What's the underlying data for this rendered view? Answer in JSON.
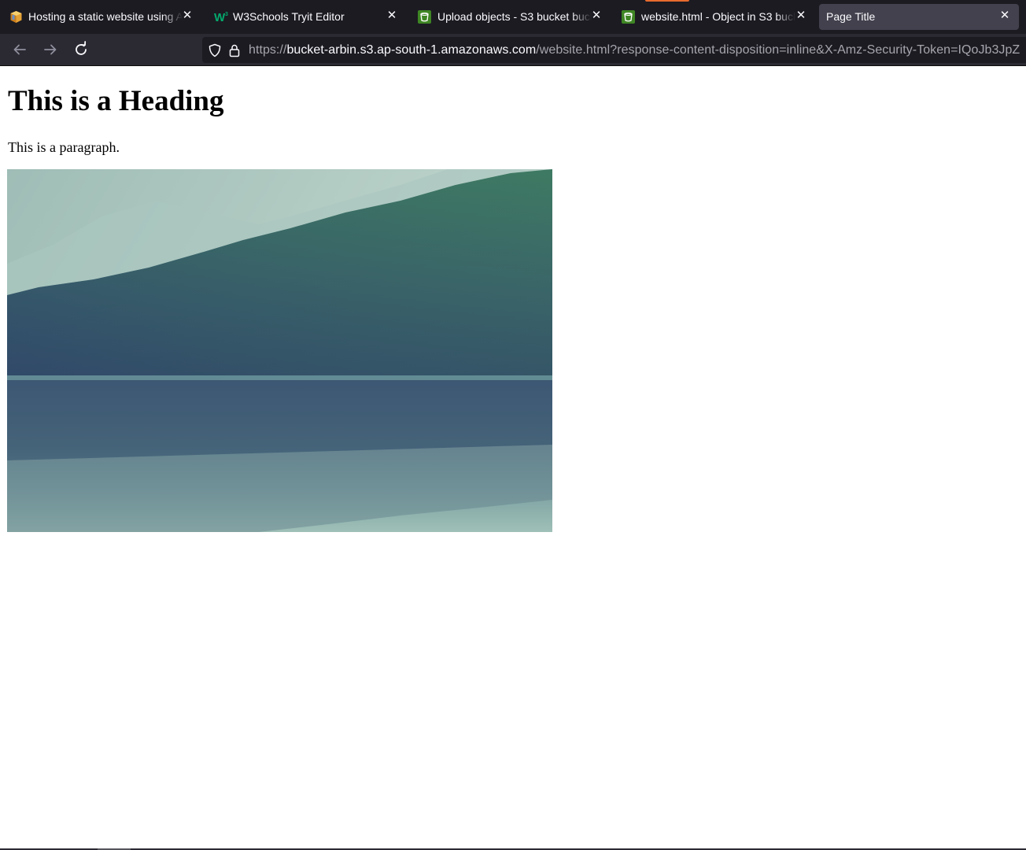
{
  "browser": {
    "tabs": [
      {
        "title": "Hosting a static website using A",
        "favicon": "aws-docs-box-icon",
        "active": false
      },
      {
        "title": "W3Schools Tryit Editor",
        "favicon": "w3schools-logo-icon",
        "active": false
      },
      {
        "title": "Upload objects - S3 bucket buck",
        "favicon": "s3-bucket-icon",
        "active": false
      },
      {
        "title": "website.html - Object in S3 buck",
        "favicon": "s3-bucket-icon",
        "active": false
      },
      {
        "title": "Page Title",
        "favicon": "",
        "active": true
      }
    ],
    "address_bar": {
      "scheme": "https://",
      "host": "bucket-arbin.s3.ap-south-1.amazonaws.com",
      "path": "/website.html?response-content-disposition=inline&X-Amz-Security-Token=IQoJb3JpZ"
    },
    "icons": {
      "back": "back-arrow-icon",
      "forward": "forward-arrow-icon",
      "reload": "reload-icon",
      "tracking": "tracking-protection-shield-icon",
      "lock": "lock-icon"
    },
    "colors": {
      "tab_strip": "#1c1b22",
      "toolbar": "#2b2a33",
      "active_tab": "#42414d",
      "loading_accent": "#e86b2c"
    }
  },
  "page": {
    "heading": "This is a Heading",
    "paragraph": "This is a paragraph.",
    "image": "lake-and-forested-mountain-photo"
  }
}
